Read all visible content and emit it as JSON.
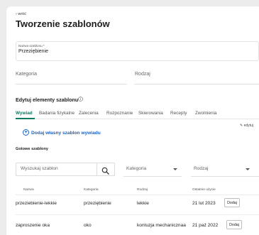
{
  "header": {
    "back_label": "wróć",
    "title": "Tworzenie szablonów"
  },
  "form": {
    "name_label": "Nazwa szablonu",
    "name_required_mark": "*",
    "name_value": "Przeziębienie",
    "category_label": "Kategoria",
    "type_label": "Rodzaj"
  },
  "elements": {
    "heading": "Edytuj elementy szablonu",
    "tabs": [
      {
        "label": "Wywiad",
        "active": true
      },
      {
        "label": "Badania fizykalne",
        "active": false
      },
      {
        "label": "Zalecenia",
        "active": false
      },
      {
        "label": "Rozpoznanie",
        "active": false
      },
      {
        "label": "Skierowania",
        "active": false
      },
      {
        "label": "Recepty",
        "active": false
      },
      {
        "label": "Zwolnienia",
        "active": false
      }
    ],
    "edit_label": "edytuj",
    "add_label": "Dodaj własny szablon wywiadu"
  },
  "ready": {
    "heading": "Gotowe szablony",
    "search_placeholder": "Wyszukaj szablon",
    "category_dropdown": "Kategoria",
    "type_dropdown": "Rodzaj",
    "columns": [
      "Nazwa",
      "Kategoria",
      "Rodzaj",
      "Ostatnie użycie"
    ],
    "rows": [
      {
        "name": "przeziebienie-lekkie",
        "category": "przeziębienie",
        "type": "lekkie",
        "last_used": "21 lut 2023",
        "action": "Dodaj"
      },
      {
        "name": "zaproszenie oka",
        "category": "oko",
        "type": "kontuzja mechanicznaa",
        "last_used": "21 paź 2022",
        "action": "Dodaj"
      }
    ]
  },
  "colors": {
    "accent_green": "#0f7a5f",
    "link_blue": "#1a62c7"
  }
}
